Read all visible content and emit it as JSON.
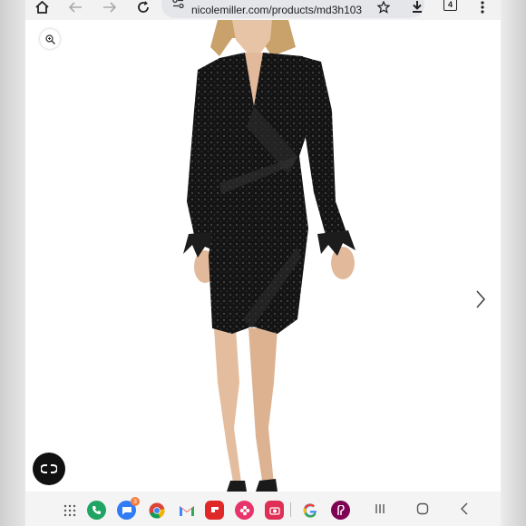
{
  "browser": {
    "url": "nicolemiller.com/products/md3h103",
    "tab_count": "4"
  },
  "product_gallery": {
    "image_alt": "Model wearing black long-sleeve sequin wrap mini dress with feather cuffs"
  },
  "dock": {
    "messages_badge": "3",
    "apps": [
      "apps-grid",
      "phone",
      "messages",
      "chrome",
      "gmail",
      "flipboard",
      "blossom",
      "camera",
      "google",
      "poshmark"
    ]
  },
  "colors": {
    "dress": "#151515",
    "skin": "#e8c4a6",
    "hair": "#c9a16b"
  }
}
